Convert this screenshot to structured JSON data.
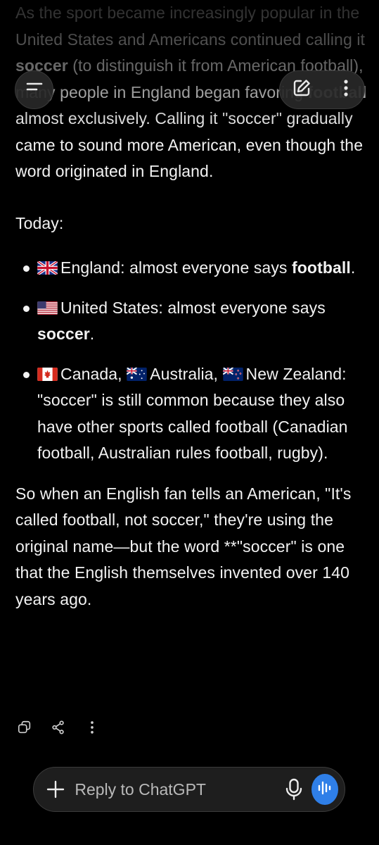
{
  "colors": {
    "background": "#000000",
    "text": "#f2f2f2",
    "accent": "#2f7fe8",
    "pill": "#282828"
  },
  "top_bar": {
    "menu_icon": "menu-lines-icon",
    "edit_icon": "edit-compose-icon",
    "more_icon": "more-vertical-icon"
  },
  "message": {
    "intro": {
      "t1": "As the sport became increasingly popular in the United States and Americans continued calling it ",
      "b1": "soccer",
      "t2": " (to distinguish it from American football), many people in England began favoring ",
      "b2": "football",
      "t3": " almost exclusively. Calling it \"soccer\" gradually came to sound more American, even though the word originated in England."
    },
    "today_label": "Today:",
    "bullets": [
      {
        "flag": "uk-flag",
        "text": "England: almost everyone says ",
        "bold": "football",
        "after": "."
      },
      {
        "flag": "us-flag",
        "text": "United States: almost everyone says ",
        "bold": "soccer",
        "after": "."
      },
      {
        "flag1": "canada-flag",
        "t1": "Canada, ",
        "flag2": "australia-flag",
        "t2": "Australia, ",
        "flag3": "new-zealand-flag",
        "t3": "New Zealand: \"soccer\" is still common because they also have other sports called football (Canadian football, Australian rules football, rugby)."
      }
    ],
    "outro": "So when an English fan tells an American, \"It's called football, not soccer,\" they're using the original name—but the word **\"soccer\" is one that the English themselves invented over 140 years ago."
  },
  "actions": {
    "copy_icon": "copy-icon",
    "share_icon": "share-icon",
    "more_icon": "more-vertical-icon"
  },
  "composer": {
    "placeholder": "Reply to ChatGPT",
    "plus_icon": "plus-icon",
    "mic_icon": "microphone-icon",
    "voice_icon": "voice-waveform-icon"
  }
}
